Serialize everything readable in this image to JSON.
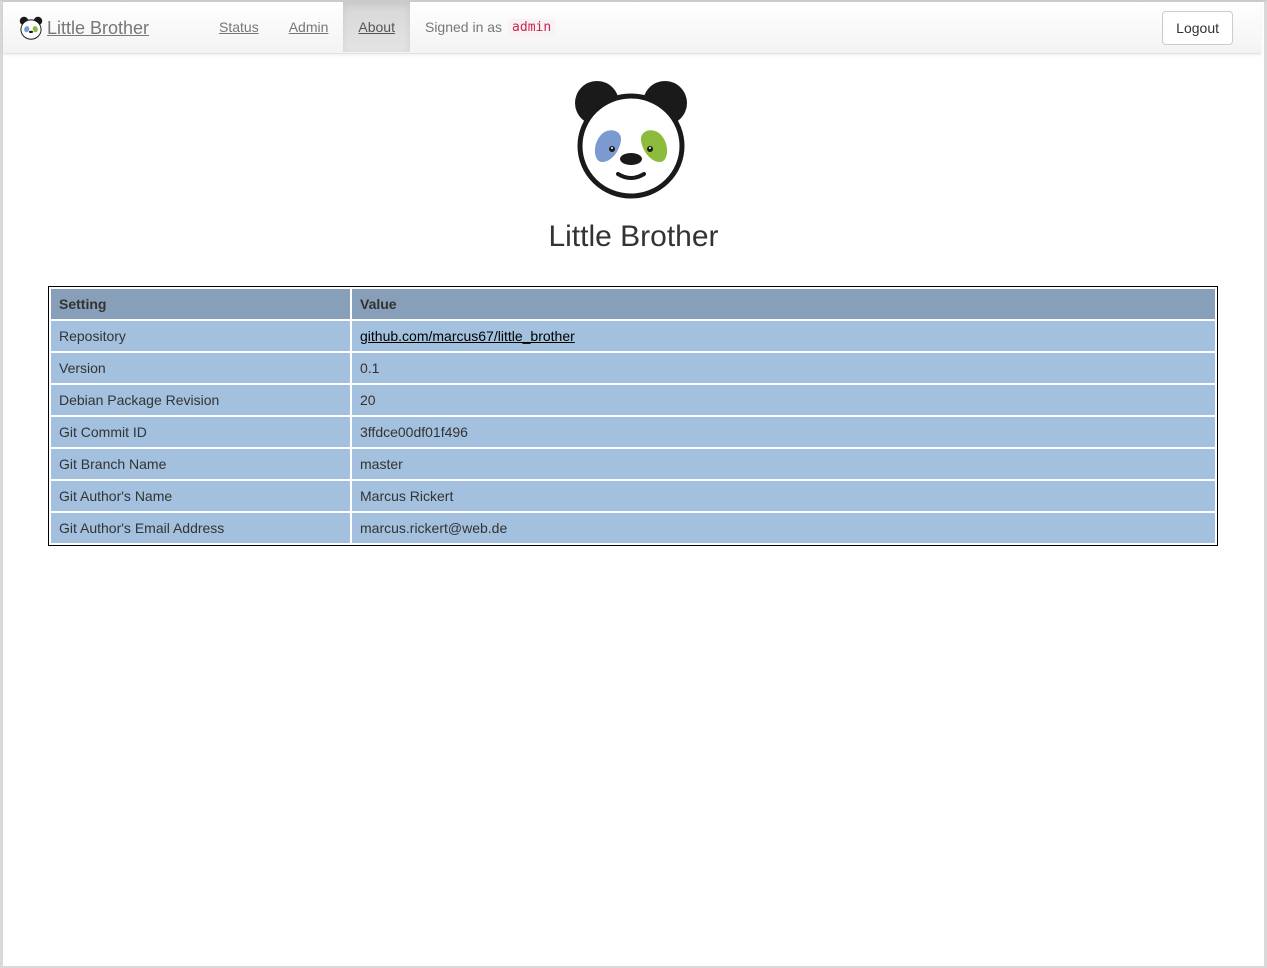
{
  "navbar": {
    "brand": "Little Brother",
    "items": [
      {
        "label": "Status"
      },
      {
        "label": "Admin"
      },
      {
        "label": "About"
      }
    ],
    "signed_in_prefix": "Signed in as",
    "user": "admin",
    "logout_label": "Logout"
  },
  "page": {
    "logo_icon": "panda-icon",
    "title": "Little Brother"
  },
  "table": {
    "headers": [
      "Setting",
      "Value"
    ],
    "rows": [
      {
        "setting": "Repository",
        "value": "github.com/marcus67/little_brother"
      },
      {
        "setting": "Version",
        "value": "0.1"
      },
      {
        "setting": "Debian Package Revision",
        "value": "20"
      },
      {
        "setting": "Git Commit ID",
        "value": "3ffdce00df01f496"
      },
      {
        "setting": "Git Branch Name",
        "value": "master"
      },
      {
        "setting": "Git Author's Name",
        "value": "Marcus Rickert"
      },
      {
        "setting": "Git Author's Email Address",
        "value": "marcus.rickert@web.de"
      }
    ]
  },
  "colors": {
    "header_row": "#879fb8",
    "data_row": "#a3c1df",
    "panda_left_patch": "#7b9bd0",
    "panda_right_patch": "#8dbb3c"
  }
}
